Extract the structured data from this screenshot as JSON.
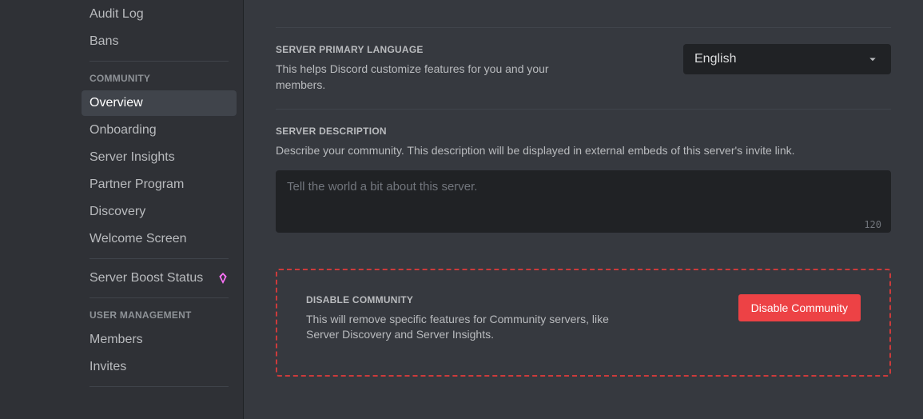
{
  "sidebar": {
    "top_items": [
      {
        "label": "Audit Log"
      },
      {
        "label": "Bans"
      }
    ],
    "community_header": "Community",
    "community_items": [
      {
        "label": "Overview",
        "active": true
      },
      {
        "label": "Onboarding"
      },
      {
        "label": "Server Insights"
      },
      {
        "label": "Partner Program"
      },
      {
        "label": "Discovery"
      },
      {
        "label": "Welcome Screen"
      }
    ],
    "boost_item": {
      "label": "Server Boost Status"
    },
    "user_mgmt_header": "User Management",
    "user_mgmt_items": [
      {
        "label": "Members"
      },
      {
        "label": "Invites"
      }
    ]
  },
  "main": {
    "language": {
      "title": "Server Primary Language",
      "desc": "This helps Discord customize features for you and your members.",
      "selected": "English"
    },
    "description": {
      "title": "Server Description",
      "desc": "Describe your community. This description will be displayed in external embeds of this server's invite link.",
      "placeholder": "Tell the world a bit about this server.",
      "value": "",
      "char_limit": "120"
    },
    "disable": {
      "title": "Disable Community",
      "desc": "This will remove specific features for Community servers, like Server Discovery and Server Insights.",
      "button": "Disable Community"
    }
  }
}
